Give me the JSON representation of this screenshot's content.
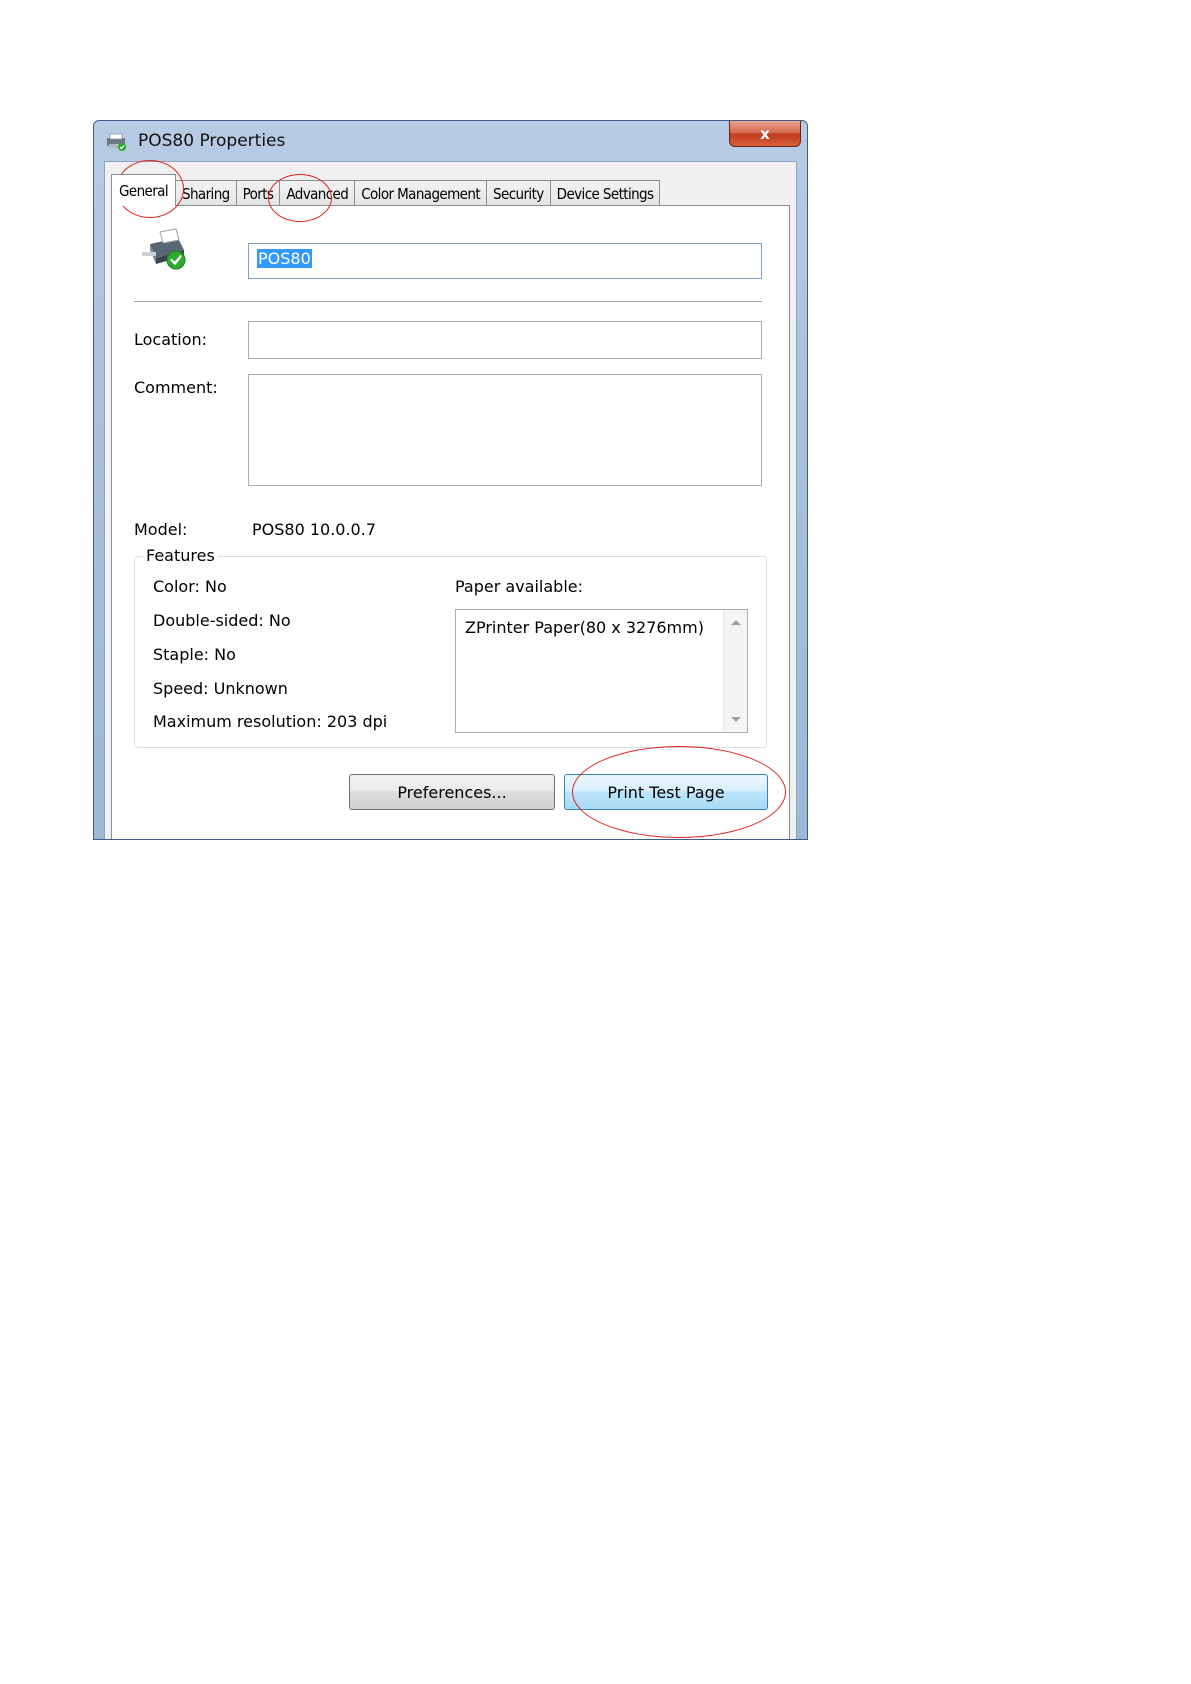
{
  "window": {
    "title": "POS80 Properties",
    "close_label": "x"
  },
  "tabs": [
    {
      "label": "General",
      "active": true
    },
    {
      "label": "Sharing",
      "active": false
    },
    {
      "label": "Ports",
      "active": false
    },
    {
      "label": "Advanced",
      "active": false
    },
    {
      "label": "Color Management",
      "active": false
    },
    {
      "label": "Security",
      "active": false
    },
    {
      "label": "Device Settings",
      "active": false
    }
  ],
  "general": {
    "printer_name": "POS80",
    "location_label": "Location:",
    "location_value": "",
    "comment_label": "Comment:",
    "comment_value": "",
    "model_label": "Model:",
    "model_value": "POS80 10.0.0.7"
  },
  "features": {
    "title": "Features",
    "color": "Color: No",
    "double_sided": "Double-sided: No",
    "staple": "Staple: No",
    "speed": "Speed: Unknown",
    "max_resolution": "Maximum resolution: 203 dpi",
    "paper_label": "Paper available:",
    "paper_items": [
      "ZPrinter Paper(80 x 3276mm)"
    ]
  },
  "buttons": {
    "preferences": "Preferences...",
    "print_test_page": "Print Test Page"
  },
  "colors": {
    "annotation": "#e02020",
    "selection": "#3399ff",
    "check_green": "#2faa2f"
  }
}
